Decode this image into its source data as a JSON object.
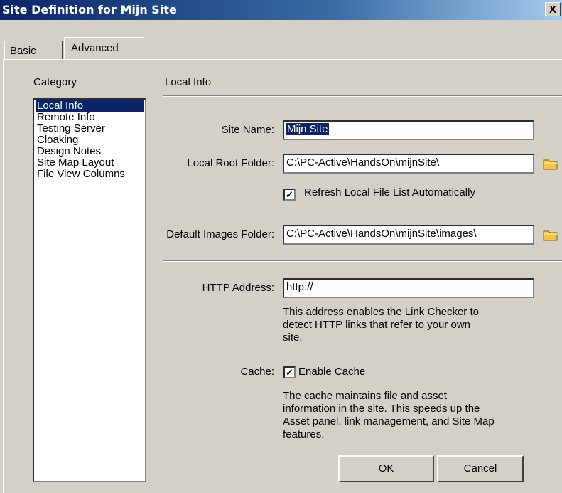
{
  "window": {
    "title": "Site Definition for Mijn Site",
    "close_label": "X"
  },
  "tabs": [
    {
      "label": "Basic"
    },
    {
      "label": "Advanced"
    }
  ],
  "category": {
    "label": "Category",
    "items": [
      {
        "label": "Local Info"
      },
      {
        "label": "Remote Info"
      },
      {
        "label": "Testing Server"
      },
      {
        "label": "Cloaking"
      },
      {
        "label": "Design Notes"
      },
      {
        "label": "Site Map Layout"
      },
      {
        "label": "File View Columns"
      }
    ],
    "selected": "Local Info"
  },
  "local_info": {
    "section_title": "Local Info",
    "site_name_label": "Site Name:",
    "site_name_value": "Mijn Site",
    "local_root_label": "Local Root Folder:",
    "local_root_value": "C:\\PC-Active\\HandsOn\\mijnSite\\",
    "refresh_label": "Refresh Local File List Automatically",
    "refresh_checked": true,
    "images_label": "Default Images Folder:",
    "images_value": "C:\\PC-Active\\HandsOn\\mijnSite\\images\\",
    "http_label": "HTTP Address:",
    "http_value": "http://",
    "http_desc": [
      "This address enables the Link Checker to",
      "detect HTTP links that refer to your own",
      "site."
    ],
    "cache_label": "Cache:",
    "cache_checkbox_label": "Enable Cache",
    "cache_checked": true,
    "cache_desc": [
      "The cache maintains file and asset",
      "information in the site.  This speeds up the",
      "Asset panel, link management, and Site Map",
      "features."
    ]
  },
  "buttons": {
    "ok": "OK",
    "cancel": "Cancel"
  },
  "colors": {
    "selection": "#0a246a",
    "face": "#d4d0c8",
    "folder": "#f5c542"
  }
}
